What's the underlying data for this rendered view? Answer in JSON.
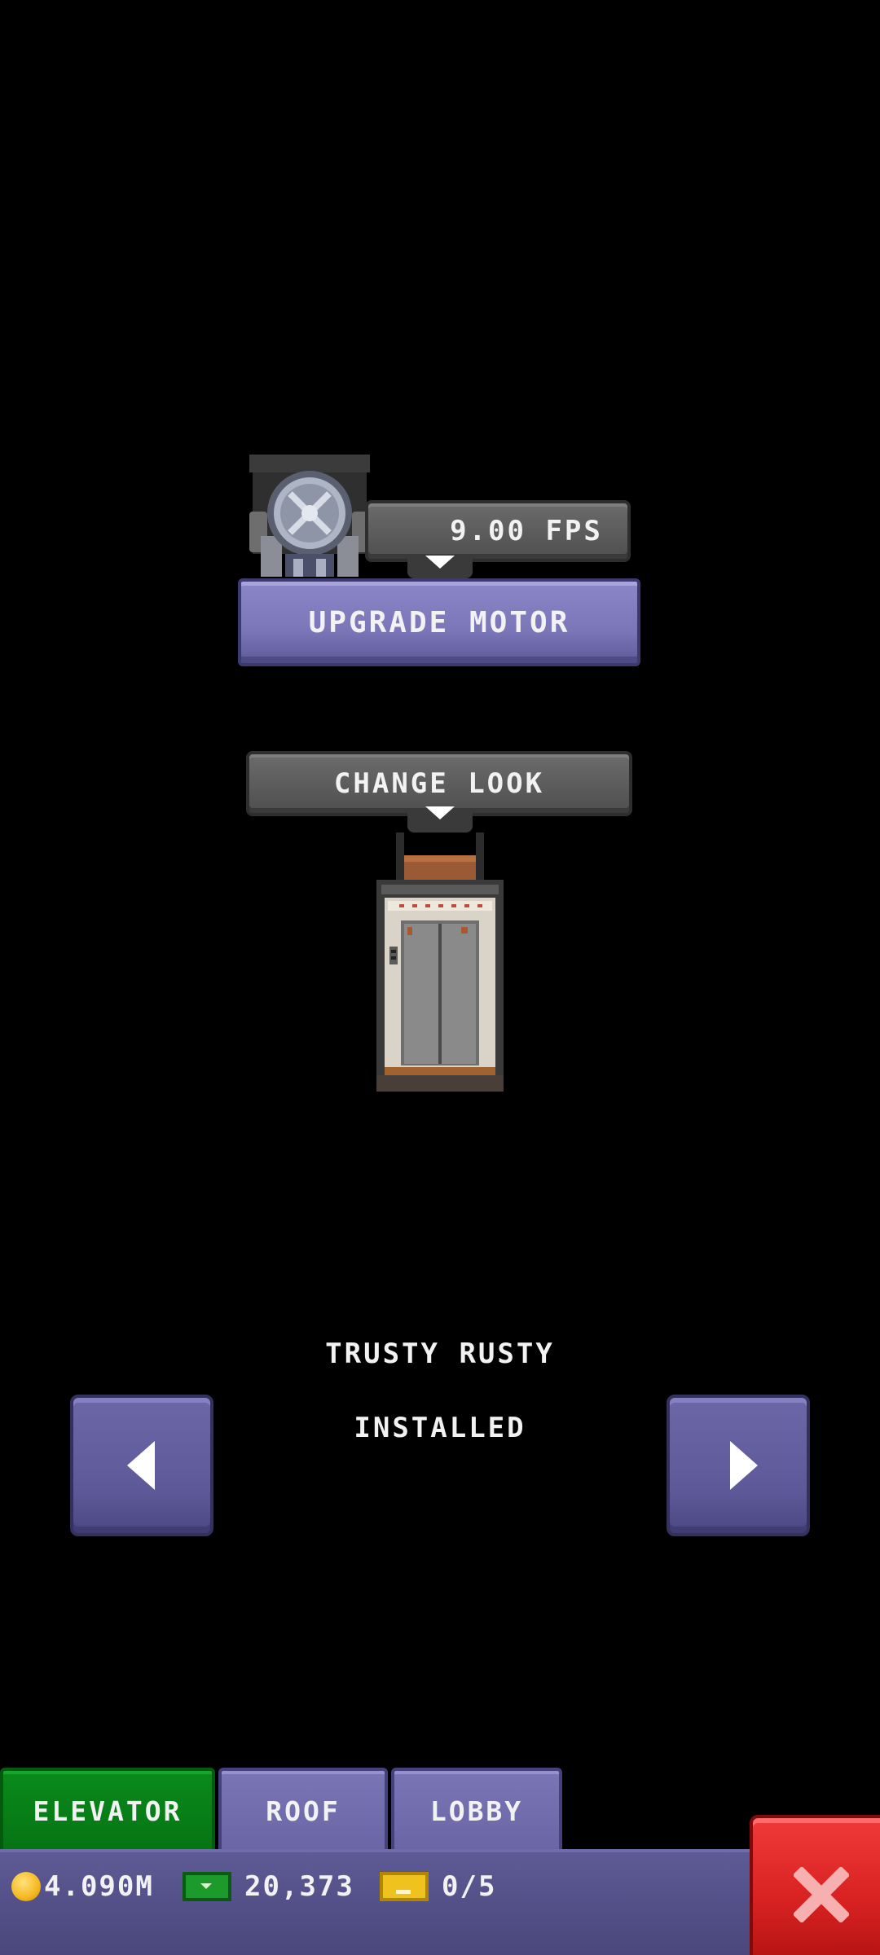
{
  "motor": {
    "speed_label": "9.00 FPS",
    "upgrade_label": "UPGRADE MOTOR"
  },
  "look": {
    "change_label": "CHANGE LOOK",
    "item_name": "TRUSTY RUSTY",
    "item_status": "INSTALLED"
  },
  "tabs": [
    {
      "label": "ELEVATOR",
      "active": true
    },
    {
      "label": "ROOF",
      "active": false
    },
    {
      "label": "LOBBY",
      "active": false
    }
  ],
  "stats": {
    "coins": "4.090M",
    "cash": "20,373",
    "tickets": "0/5"
  },
  "icons": {
    "coin": "coin-icon",
    "cash": "cash-icon",
    "ticket": "ticket-icon",
    "close": "close-icon",
    "prev": "arrow-left-icon",
    "next": "arrow-right-icon"
  },
  "colors": {
    "background": "#000000",
    "button_purple": "#7a76b8",
    "tab_active_green": "#067414",
    "close_red": "#d82222",
    "coin_gold": "#f5b820"
  }
}
